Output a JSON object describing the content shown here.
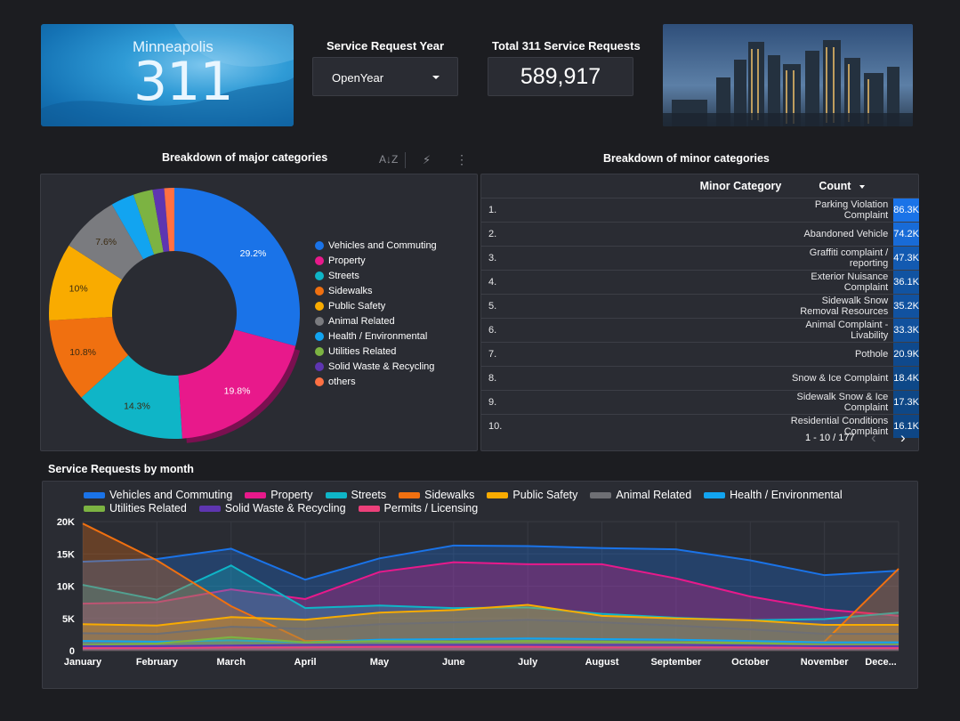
{
  "header": {
    "logo_city": "Minneapolis",
    "logo_number": "311",
    "year_label": "Service Request Year",
    "year_value": "OpenYear",
    "total_label": "Total 311 Service Requests",
    "total_value": "589,917"
  },
  "major": {
    "title": "Breakdown of major categories",
    "legend": [
      {
        "label": "Vehicles and Commuting",
        "color": "#1a73e8"
      },
      {
        "label": "Property",
        "color": "#e8198b"
      },
      {
        "label": "Streets",
        "color": "#0fb5c7"
      },
      {
        "label": "Sidewalks",
        "color": "#f07010"
      },
      {
        "label": "Public Safety",
        "color": "#f9ab00"
      },
      {
        "label": "Animal Related",
        "color": "#7a7b7f"
      },
      {
        "label": "Health / Environmental",
        "color": "#12a4f0"
      },
      {
        "label": "Utilities Related",
        "color": "#7cb342"
      },
      {
        "label": "Solid Waste & Recycling",
        "color": "#5e35b1"
      },
      {
        "label": "others",
        "color": "#ff7043"
      }
    ]
  },
  "minor": {
    "title": "Breakdown of minor categories",
    "col_category": "Minor Category",
    "col_count": "Count",
    "rows": [
      {
        "rank": "1.",
        "category": "Parking Violation Complaint",
        "count": "86.3K",
        "value": 86.3
      },
      {
        "rank": "2.",
        "category": "Abandoned Vehicle",
        "count": "74.2K",
        "value": 74.2
      },
      {
        "rank": "3.",
        "category": "Graffiti complaint / reporting",
        "count": "47.3K",
        "value": 47.3
      },
      {
        "rank": "4.",
        "category": "Exterior Nuisance Complaint",
        "count": "36.1K",
        "value": 36.1
      },
      {
        "rank": "5.",
        "category": "Sidewalk Snow Removal Resources",
        "count": "35.2K",
        "value": 35.2
      },
      {
        "rank": "6.",
        "category": "Animal Complaint - Livability",
        "count": "33.3K",
        "value": 33.3
      },
      {
        "rank": "7.",
        "category": "Pothole",
        "count": "20.9K",
        "value": 20.9
      },
      {
        "rank": "8.",
        "category": "Snow & Ice Complaint",
        "count": "18.4K",
        "value": 18.4
      },
      {
        "rank": "9.",
        "category": "Sidewalk Snow & Ice Complaint",
        "count": "17.3K",
        "value": 17.3
      },
      {
        "rank": "10.",
        "category": "Residential Conditions Complaint",
        "count": "16.1K",
        "value": 16.1
      }
    ],
    "pager": "1 - 10 / 177"
  },
  "monthly_title": "Service Requests by month",
  "chart_data": [
    {
      "type": "pie",
      "title": "Breakdown of major categories",
      "labels": [
        "Vehicles and Commuting",
        "Property",
        "Streets",
        "Sidewalks",
        "Public Safety",
        "Animal Related",
        "Health / Environmental",
        "Utilities Related",
        "Solid Waste & Recycling",
        "others"
      ],
      "values": [
        29.2,
        19.8,
        14.3,
        10.8,
        10.0,
        7.6,
        3.0,
        2.5,
        1.5,
        1.3
      ],
      "slice_labels": [
        "29.2%",
        "19.8%",
        "14.3%",
        "10.8%",
        "10%",
        "7.6%",
        "",
        "",
        "",
        ""
      ],
      "colors": [
        "#1a73e8",
        "#e8198b",
        "#0fb5c7",
        "#f07010",
        "#f9ab00",
        "#7a7b7f",
        "#12a4f0",
        "#7cb342",
        "#5e35b1",
        "#ff7043"
      ],
      "legend_position": "right"
    },
    {
      "type": "area",
      "title": "Service Requests by month",
      "categories": [
        "January",
        "February",
        "March",
        "April",
        "May",
        "June",
        "July",
        "August",
        "September",
        "October",
        "November",
        "December"
      ],
      "category_labels": [
        "January",
        "February",
        "March",
        "April",
        "May",
        "June",
        "July",
        "August",
        "September",
        "October",
        "November",
        "Dece..."
      ],
      "ylim": [
        0,
        20000
      ],
      "yticks": [
        "0",
        "5K",
        "10K",
        "15K",
        "20K"
      ],
      "legend_position": "top",
      "series": [
        {
          "name": "Vehicles and Commuting",
          "color": "#1a73e8",
          "values": [
            13800,
            14200,
            15800,
            11000,
            14300,
            16300,
            16200,
            15900,
            15700,
            14000,
            11700,
            12400
          ]
        },
        {
          "name": "Property",
          "color": "#e8198b",
          "values": [
            7300,
            7500,
            9500,
            8000,
            12200,
            13700,
            13400,
            13400,
            11200,
            8400,
            6400,
            5400
          ]
        },
        {
          "name": "Streets",
          "color": "#0fb5c7",
          "values": [
            10200,
            7900,
            13200,
            6600,
            7000,
            6600,
            6700,
            5700,
            5100,
            4700,
            4900,
            5900
          ]
        },
        {
          "name": "Sidewalks",
          "color": "#f07010",
          "values": [
            19700,
            14000,
            6900,
            1500,
            1600,
            1400,
            1300,
            1300,
            1300,
            1400,
            1400,
            12700
          ]
        },
        {
          "name": "Public Safety",
          "color": "#f9ab00",
          "values": [
            4100,
            3900,
            5200,
            4800,
            5900,
            6300,
            7100,
            5400,
            5000,
            4700,
            4000,
            4000
          ]
        },
        {
          "name": "Animal Related",
          "color": "#6e6f74",
          "values": [
            2700,
            2600,
            3700,
            3400,
            4100,
            4400,
            4800,
            4400,
            3900,
            3300,
            2600,
            2600
          ]
        },
        {
          "name": "Health / Environmental",
          "color": "#12a4f0",
          "values": [
            1500,
            1400,
            1600,
            1300,
            1700,
            1800,
            1900,
            1800,
            1700,
            1500,
            1300,
            1300
          ]
        },
        {
          "name": "Utilities Related",
          "color": "#7cb342",
          "values": [
            900,
            1100,
            2100,
            1300,
            1500,
            1400,
            1500,
            1400,
            1300,
            1200,
            900,
            900
          ]
        },
        {
          "name": "Solid Waste & Recycling",
          "color": "#5e35b1",
          "values": [
            700,
            700,
            800,
            900,
            900,
            900,
            900,
            900,
            900,
            800,
            700,
            700
          ]
        },
        {
          "name": "Permits / Licensing",
          "color": "#ec407a",
          "values": [
            400,
            400,
            500,
            500,
            600,
            600,
            600,
            500,
            500,
            500,
            400,
            400
          ]
        }
      ]
    }
  ]
}
